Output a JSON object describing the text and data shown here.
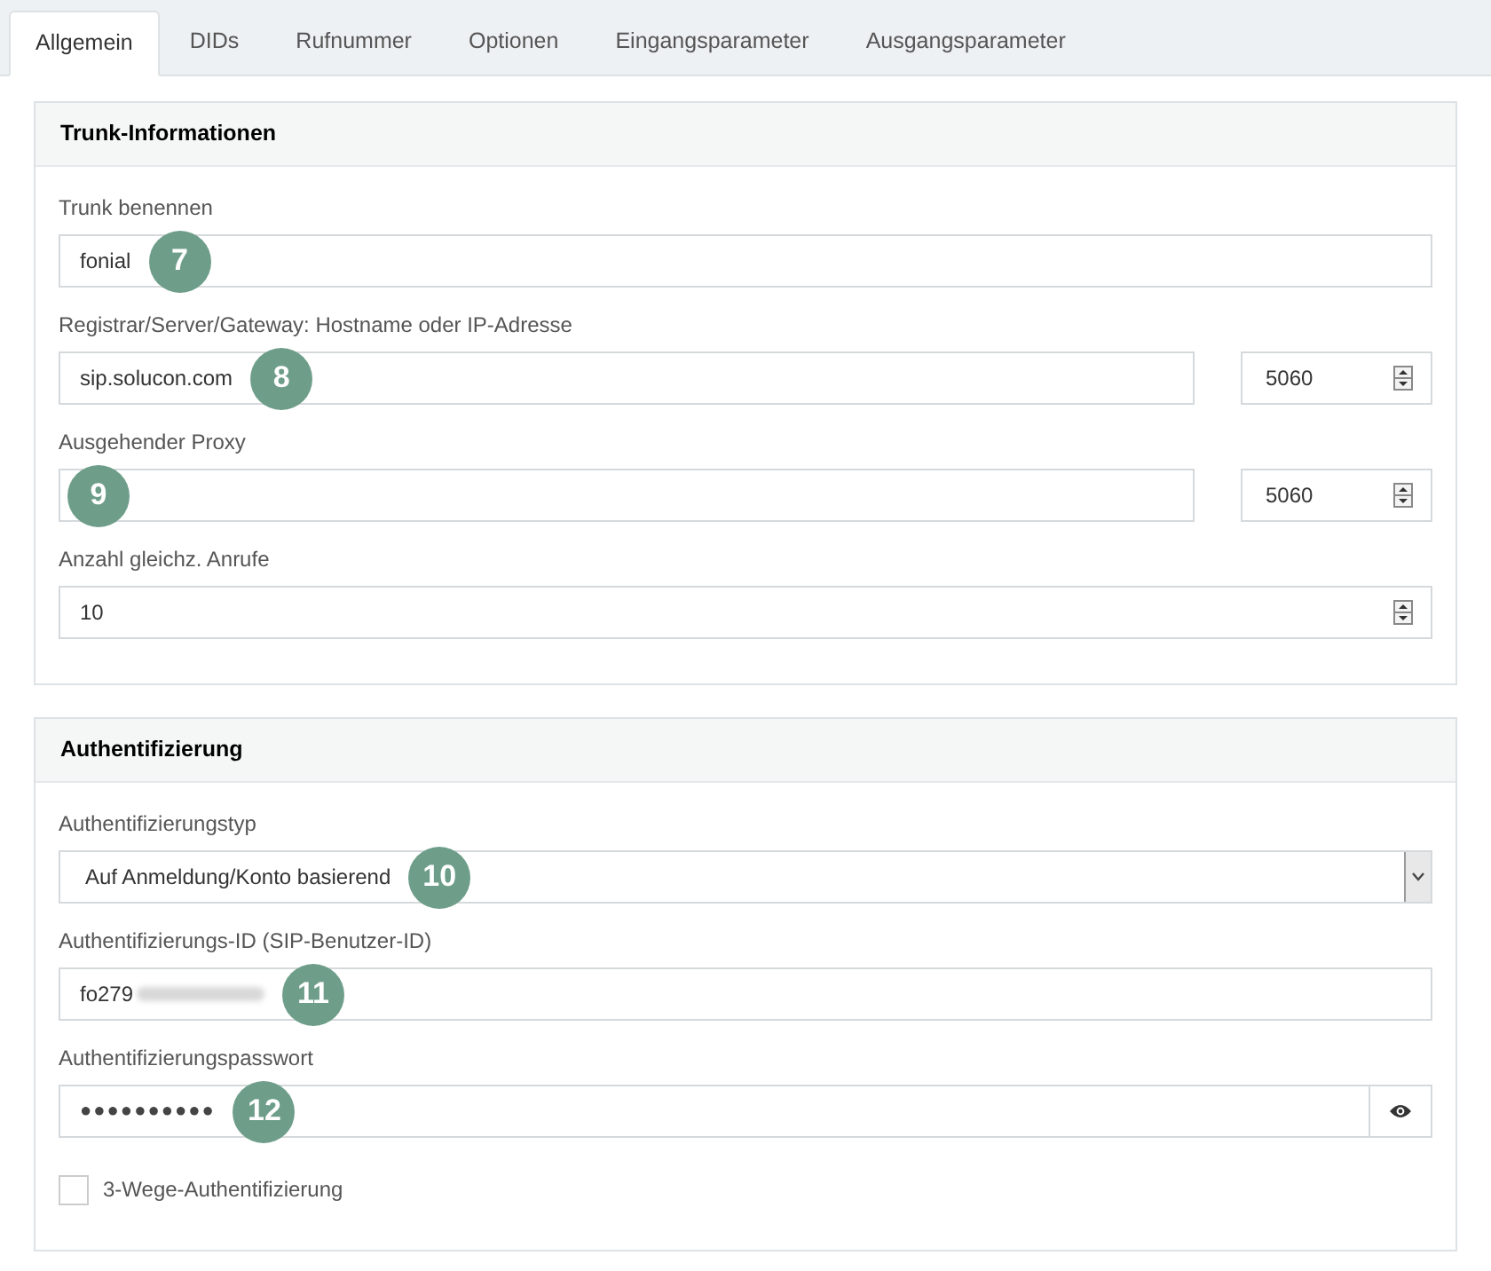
{
  "tabs": [
    {
      "label": "Allgemein",
      "selected": true
    },
    {
      "label": "DIDs",
      "selected": false
    },
    {
      "label": "Rufnummer",
      "selected": false
    },
    {
      "label": "Optionen",
      "selected": false
    },
    {
      "label": "Eingangsparameter",
      "selected": false
    },
    {
      "label": "Ausgangsparameter",
      "selected": false
    }
  ],
  "sections": [
    {
      "title": "Trunk-Informationen",
      "fields": [
        {
          "kind": "text",
          "label": "Trunk benennen",
          "value": "fonial",
          "badge": "7"
        },
        {
          "kind": "text_port",
          "label": "Registrar/Server/Gateway: Hostname oder IP-Adresse",
          "value": "sip.solucon.com",
          "badge": "8",
          "port": "5060"
        },
        {
          "kind": "text_port",
          "label": "Ausgehender Proxy",
          "badge": "9",
          "port": "5060"
        },
        {
          "kind": "number",
          "label": "Anzahl gleichz. Anrufe",
          "value": "10"
        }
      ]
    },
    {
      "title": "Authentifizierung",
      "fields": [
        {
          "kind": "select",
          "label": "Authentifizierungstyp",
          "value": "Auf Anmeldung/Konto basierend",
          "badge": "10"
        },
        {
          "kind": "text",
          "label": "Authentifizierungs-ID (SIP-Benutzer-ID)",
          "value": "fo279",
          "redacted": true,
          "badge": "11"
        },
        {
          "kind": "password",
          "label": "Authentifizierungspasswort",
          "value": "●●●●●●●●●●",
          "badge": "12"
        },
        {
          "kind": "checkbox",
          "label": "3-Wege-Authentifizierung",
          "checked": false
        }
      ]
    }
  ]
}
